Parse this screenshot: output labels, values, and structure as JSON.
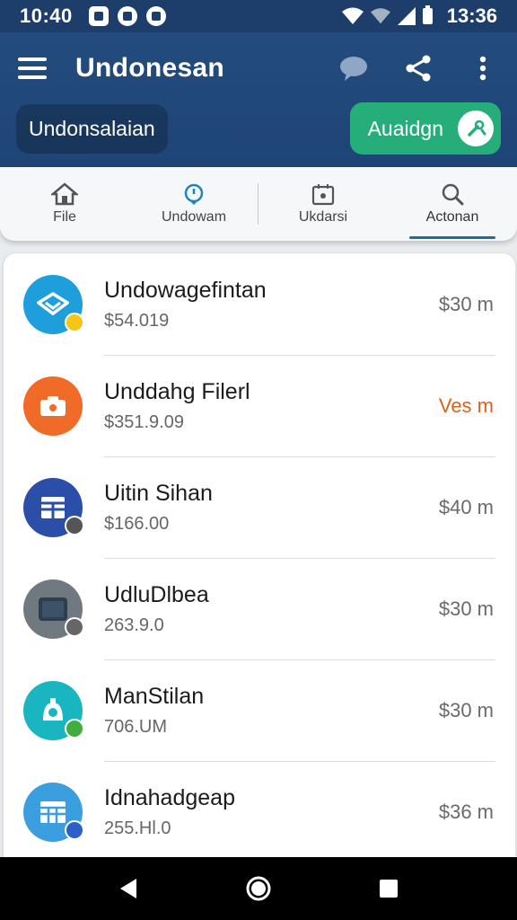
{
  "status": {
    "time_left": "10:40",
    "time_right": "13:36"
  },
  "header": {
    "title": "Undonesan",
    "chip_label": "Undonsalaian",
    "cta_label": "Auaidgn"
  },
  "tabs": [
    {
      "label": "File",
      "icon": "home-icon"
    },
    {
      "label": "Undowam",
      "icon": "location-pin-icon"
    },
    {
      "label": "Ukdarsi",
      "icon": "calendar-icon"
    },
    {
      "label": "Actonan",
      "icon": "search-icon"
    }
  ],
  "items": [
    {
      "title": "Undowagefintan",
      "sub": "$54.019",
      "meta": "$30 m",
      "color": "#1e9fdc",
      "badge": "#f5c518",
      "icon": "diamond-icon"
    },
    {
      "title": "Unddahg Filerl",
      "sub": "$351.9.09",
      "meta": "Ves m",
      "color": "#f06a28",
      "badge": "",
      "icon": "camera-icon"
    },
    {
      "title": "Uitin Sihan",
      "sub": "$166.00",
      "meta": "$40 m",
      "color": "#2b4fa8",
      "badge": "#555555",
      "icon": "grid-icon"
    },
    {
      "title": "UdluDlbea",
      "sub": "263.9.0",
      "meta": "$30 m",
      "color": "#707880",
      "badge": "#666666",
      "icon": "tablet-icon"
    },
    {
      "title": "ManStilan",
      "sub": "706.UM",
      "meta": "$30 m",
      "color": "#19b6c2",
      "badge": "#3fae3f",
      "icon": "gear-icon"
    },
    {
      "title": "Idnahadgeap",
      "sub": "255.Hl.0",
      "meta": "$36 m",
      "color": "#3b9ede",
      "badge": "#2c5fc9",
      "icon": "table-icon"
    }
  ],
  "colors": {
    "header": "#234b7d",
    "cta": "#25ae7a",
    "accent_meta": "#d9621e"
  }
}
